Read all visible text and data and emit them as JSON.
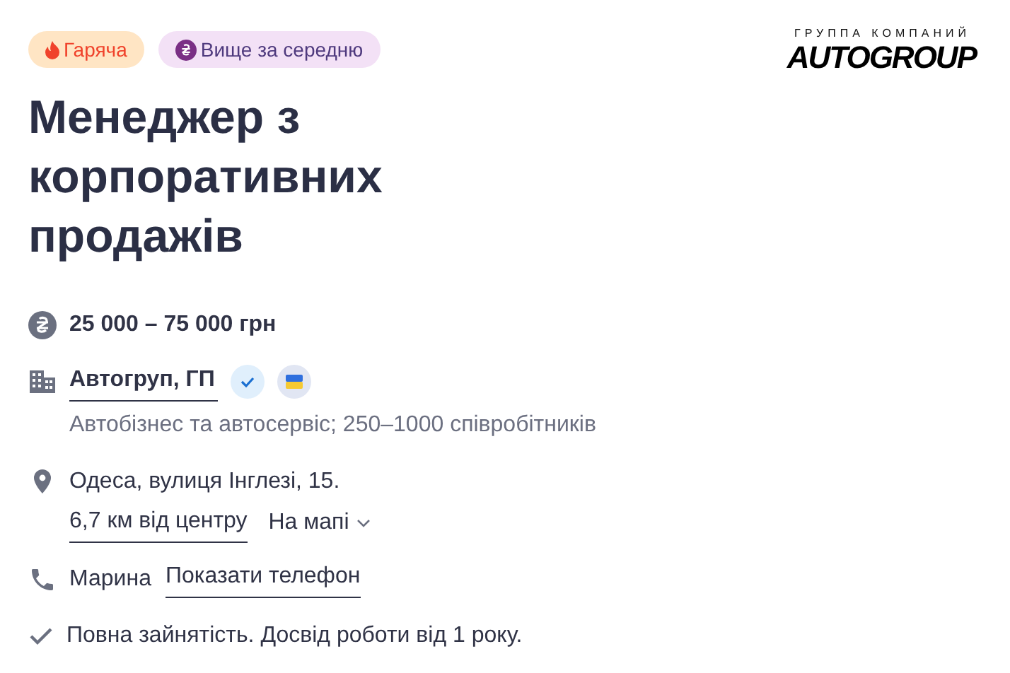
{
  "badges": [
    {
      "kind": "hot",
      "label": "Гаряча"
    },
    {
      "kind": "above",
      "label": "Вище за середню"
    }
  ],
  "logo": {
    "caption": "ГРУППА КОМПАНИЙ",
    "name": "AUTOGROUP"
  },
  "title": "Менеджер з корпоративних продажів",
  "salary": "25 000 – 75 000 грн",
  "company": {
    "name": "Автогруп, ГП",
    "verified": true,
    "description": "Автобізнес та автосервіс; 250–1000 співробітників"
  },
  "address": {
    "street": "Одеса, вулиця Інглезі, 15.",
    "distance": "6,7 км від центру",
    "map_link": "На мапі"
  },
  "contact": {
    "name": "Марина",
    "phone_link": "Показати телефон"
  },
  "conditions": "Повна зайнятість. Досвід роботи від 1 року."
}
